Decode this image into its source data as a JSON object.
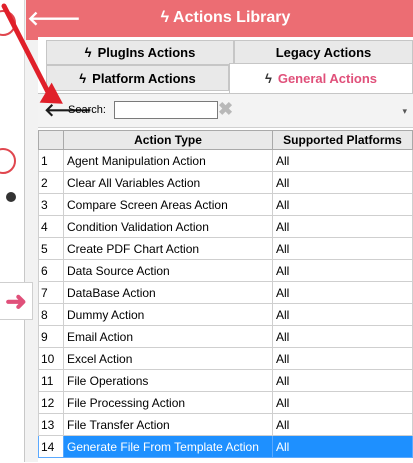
{
  "window": {
    "title": "Actions Library",
    "title_icon": "lightning-icon",
    "accent_color": "#ec6d73"
  },
  "tabs": [
    {
      "label": "PlugIns Actions",
      "icon": "lightning-plug-icon"
    },
    {
      "label": "Legacy Actions",
      "icon": ""
    },
    {
      "label": "Platform Actions",
      "icon": "lightning-platform-icon"
    },
    {
      "label": "General Actions",
      "icon": "lightning-general-icon",
      "active": true
    }
  ],
  "search": {
    "label": "Search:",
    "value": ""
  },
  "grid": {
    "columns": [
      "Action Type",
      "Supported Platforms"
    ],
    "rows": [
      {
        "index": "1",
        "action": "Agent Manipulation Action",
        "platforms": "All"
      },
      {
        "index": "2",
        "action": "Clear All Variables Action",
        "platforms": "All"
      },
      {
        "index": "3",
        "action": "Compare Screen Areas Action",
        "platforms": "All"
      },
      {
        "index": "4",
        "action": "Condition Validation Action",
        "platforms": "All"
      },
      {
        "index": "5",
        "action": "Create PDF Chart Action",
        "platforms": "All"
      },
      {
        "index": "6",
        "action": "Data Source Action",
        "platforms": "All"
      },
      {
        "index": "7",
        "action": "DataBase Action",
        "platforms": "All"
      },
      {
        "index": "8",
        "action": "Dummy Action",
        "platforms": "All"
      },
      {
        "index": "9",
        "action": "Email Action",
        "platforms": "All"
      },
      {
        "index": "10",
        "action": "Excel Action",
        "platforms": "All"
      },
      {
        "index": "11",
        "action": "File Operations",
        "platforms": "All"
      },
      {
        "index": "12",
        "action": "File Processing Action",
        "platforms": "All"
      },
      {
        "index": "13",
        "action": "File Transfer Action",
        "platforms": "All"
      },
      {
        "index": "14",
        "action": "Generate File From Template Action",
        "platforms": "All",
        "selected": true
      }
    ],
    "selection_color": "#1e90ff"
  }
}
